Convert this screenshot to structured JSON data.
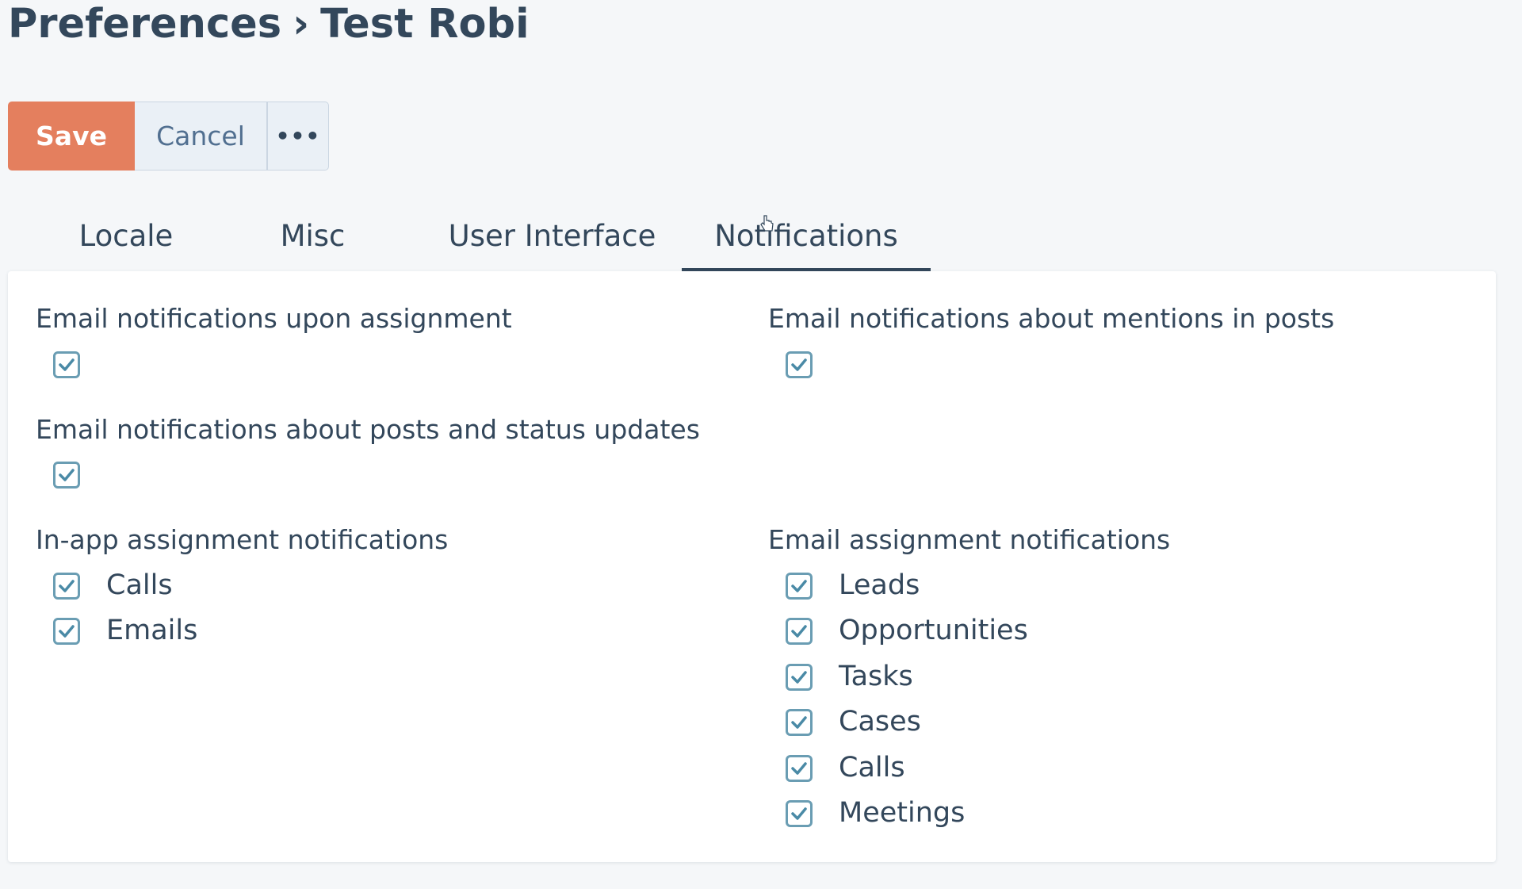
{
  "header": {
    "breadcrumb_parent": "Preferences",
    "separator": "›",
    "breadcrumb_current": "Test Robi"
  },
  "toolbar": {
    "save_label": "Save",
    "cancel_label": "Cancel",
    "more_label": "•••"
  },
  "tabs": [
    {
      "label": "Locale",
      "active": false
    },
    {
      "label": "Misc",
      "active": false
    },
    {
      "label": "User Interface",
      "active": false
    },
    {
      "label": "Notifications",
      "active": true
    }
  ],
  "fields": {
    "email_upon_assignment": {
      "label": "Email notifications upon assignment",
      "checked": true
    },
    "email_mentions": {
      "label": "Email notifications about mentions in posts",
      "checked": true
    },
    "email_posts_status": {
      "label": "Email notifications about posts and status updates",
      "checked": true
    },
    "in_app_assignment": {
      "label": "In-app assignment notifications",
      "options": [
        {
          "label": "Calls",
          "checked": true
        },
        {
          "label": "Emails",
          "checked": true
        }
      ]
    },
    "email_assignment": {
      "label": "Email assignment notifications",
      "options": [
        {
          "label": "Leads",
          "checked": true
        },
        {
          "label": "Opportunities",
          "checked": true
        },
        {
          "label": "Tasks",
          "checked": true
        },
        {
          "label": "Cases",
          "checked": true
        },
        {
          "label": "Calls",
          "checked": true
        },
        {
          "label": "Meetings",
          "checked": true
        }
      ]
    }
  },
  "colors": {
    "primary_button": "#e47f5e",
    "text": "#33475b",
    "checkbox_border": "#6a9db3",
    "checkmark": "#4a8aa6"
  }
}
